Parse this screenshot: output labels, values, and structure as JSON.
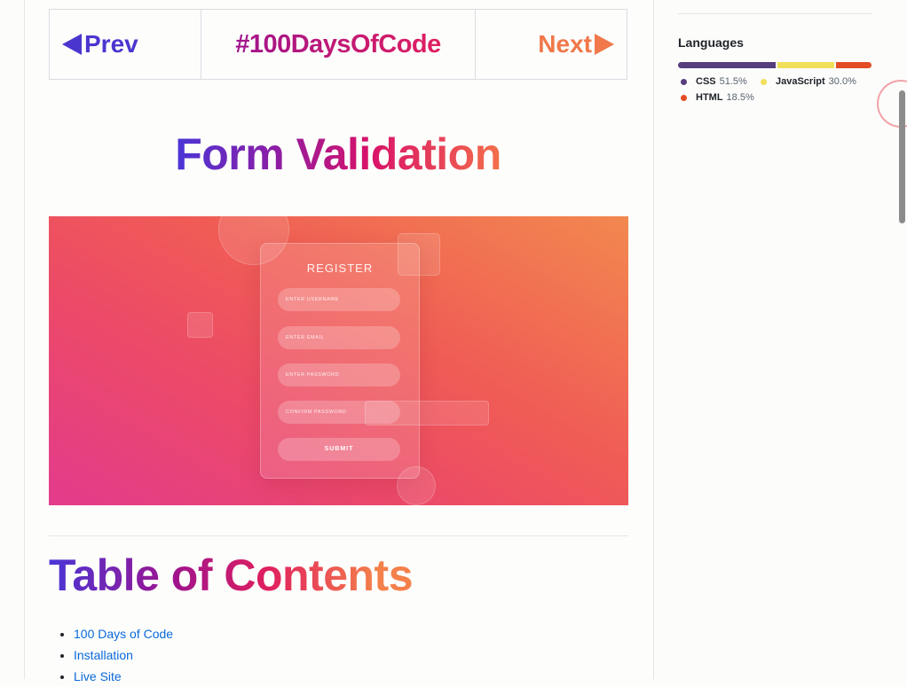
{
  "nav": {
    "prev_label": "Prev",
    "hashtag": "#100DaysOfCode",
    "next_label": "Next"
  },
  "title": "Form Validation",
  "banner": {
    "form_title": "REGISTER",
    "fields": [
      "ENTER USERNAME",
      "ENTER EMAIL",
      "ENTER PASSWORD",
      "CONFIRM PASSWORD"
    ],
    "submit_label": "SUBMIT"
  },
  "toc": {
    "title": "Table of Contents",
    "items": [
      "100 Days of Code",
      "Installation",
      "Live Site"
    ]
  },
  "languages": {
    "heading": "Languages",
    "items": [
      {
        "name": "CSS",
        "percent": "51.5%",
        "value": 51.5,
        "color": "#563d7c"
      },
      {
        "name": "JavaScript",
        "percent": "30.0%",
        "value": 30.0,
        "color": "#f1e05a"
      },
      {
        "name": "HTML",
        "percent": "18.5%",
        "value": 18.5,
        "color": "#e34c26"
      }
    ]
  },
  "colors": {
    "link": "#0969da",
    "prev": "#4a36cf",
    "next": "#f0784a"
  }
}
